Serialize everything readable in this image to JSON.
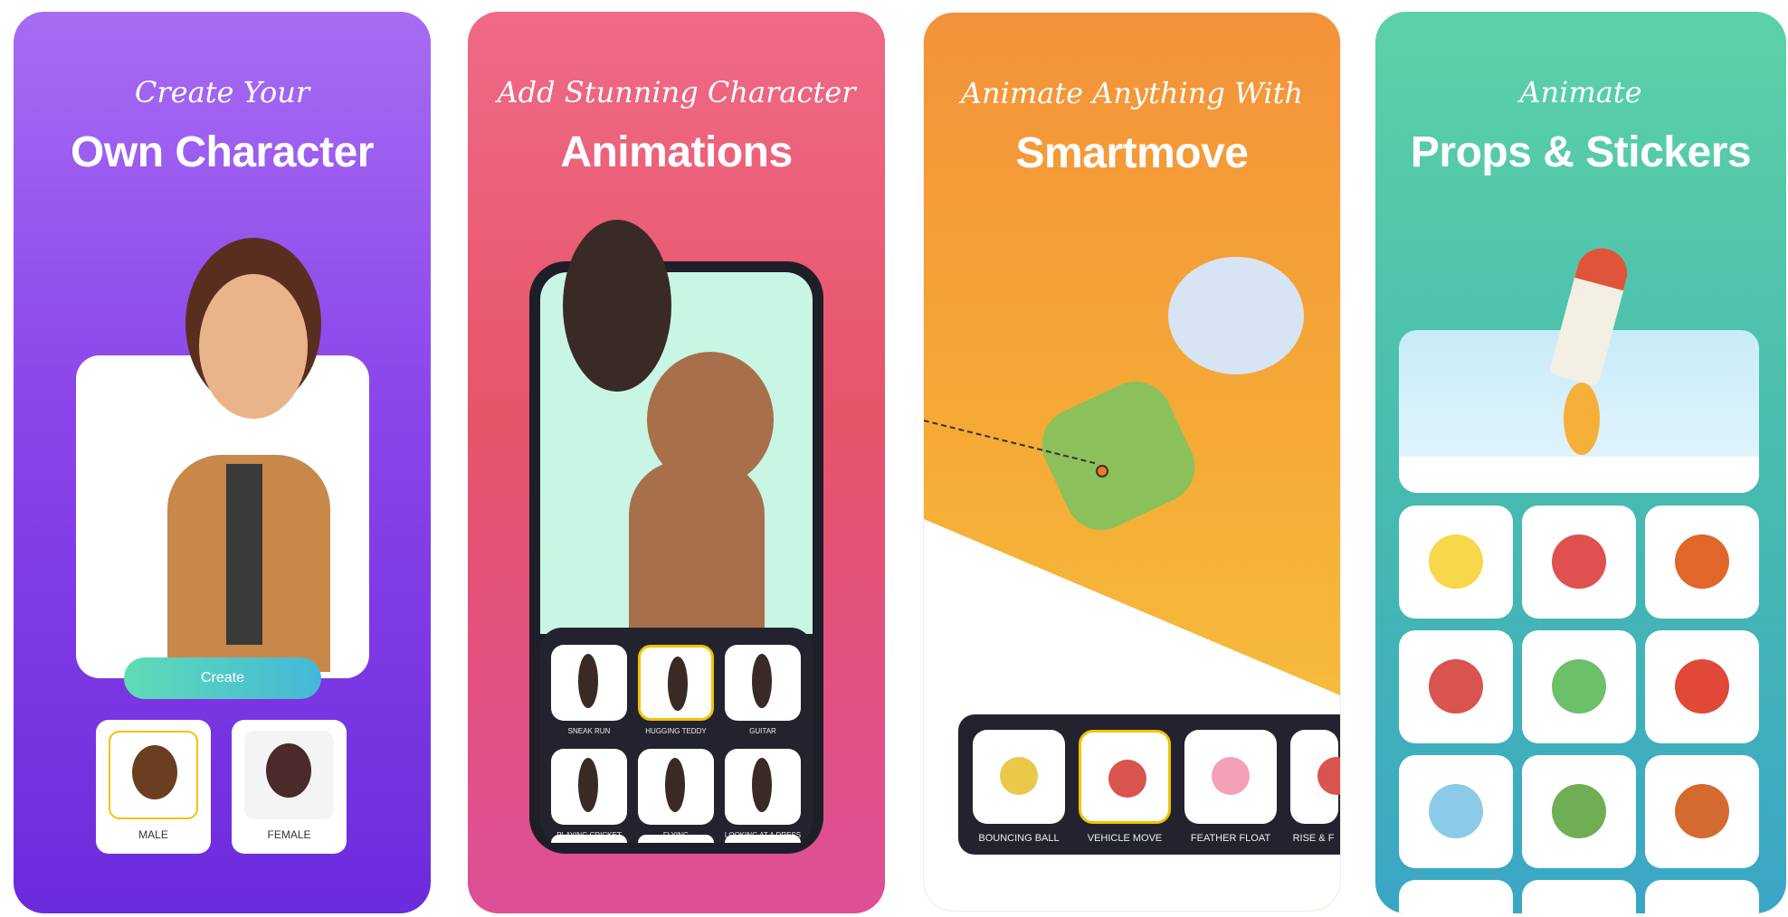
{
  "panels": [
    {
      "script": "Create Your",
      "headline": "Own Character",
      "button": "Create",
      "options": [
        "MALE",
        "FEMALE"
      ],
      "selected": "MALE"
    },
    {
      "script": "Add Stunning Character",
      "headline": "Animations",
      "animations": [
        "SNEAK RUN",
        "HUGGING TEDDY",
        "GUITAR",
        "PLAYING CRICKET",
        "FLYING",
        "LOOKING AT A DRESS"
      ],
      "selected": "HUGGING TEDDY"
    },
    {
      "script": "Animate Anything With",
      "headline": "Smartmove",
      "moves": [
        "BOUNCING BALL",
        "VEHICLE MOVE",
        "FEATHER FLOAT",
        "RISE & F"
      ],
      "selected": "VEHICLE MOVE"
    },
    {
      "script": "Animate",
      "headline": "Props & Stickers",
      "stickers": [
        "sun-icon",
        "alarm-clock-icon",
        "pumpkin-icon",
        "bell-icon",
        "recycle-icon",
        "crab-icon",
        "car-icon",
        "paint-splash-icon",
        "basketball-icon"
      ]
    }
  ],
  "colors": {
    "purple": "#8a44ea",
    "pink": "#e6546a",
    "orange": "#f5ac36",
    "teal": "#48bcae",
    "selected_border": "#f2c200"
  }
}
